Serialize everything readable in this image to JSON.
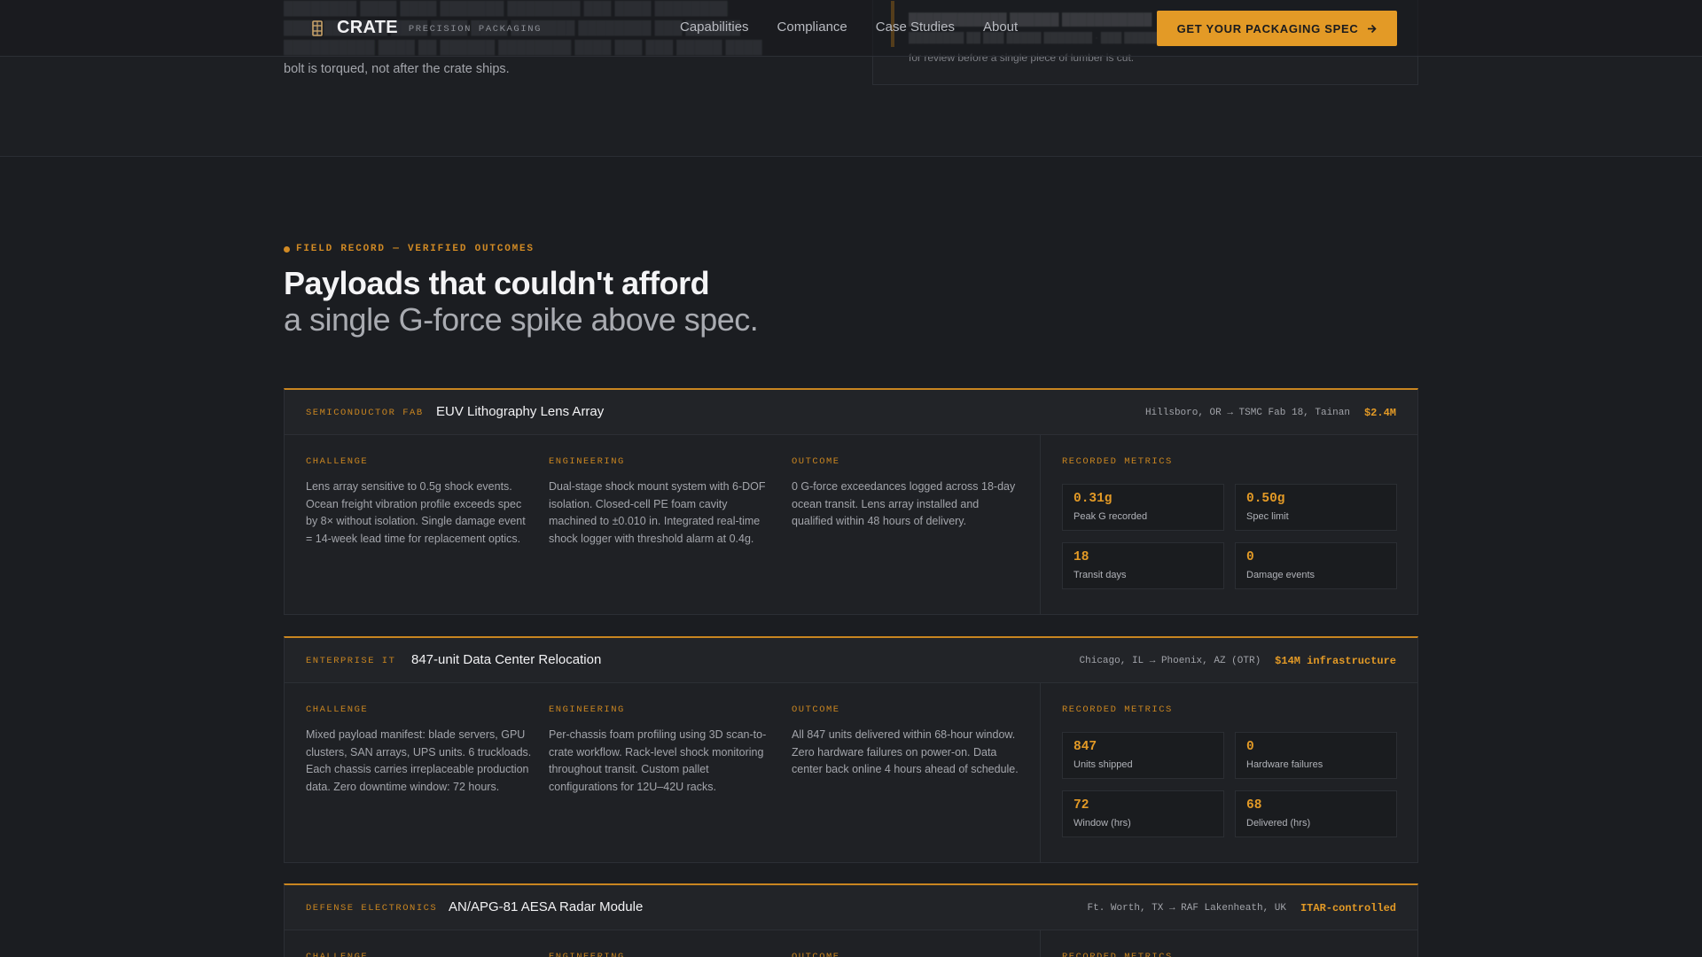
{
  "top": {
    "last_line": "bolt is torqued, not after the crate ships.",
    "card_sub": "for review before a single piece of lumber is cut."
  },
  "nav": {
    "brand": "CRATE",
    "tagline": "PRECISION PACKAGING",
    "links": [
      "Capabilities",
      "Compliance",
      "Case Studies",
      "About"
    ],
    "cta": "GET YOUR PACKAGING SPEC"
  },
  "section": {
    "eyebrow": "FIELD RECORD — VERIFIED OUTCOMES",
    "title": "Payloads that couldn't afford",
    "subtitle": "a single G-force spike above spec."
  },
  "labels": {
    "challenge": "CHALLENGE",
    "engineering": "ENGINEERING",
    "outcome": "OUTCOME",
    "metrics": "RECORDED METRICS"
  },
  "cases": [
    {
      "tag": "SEMICONDUCTOR FAB",
      "title": "EUV Lithography Lens Array",
      "route": "Hillsboro, OR → TSMC Fab 18, Tainan",
      "value": "$2.4M",
      "challenge": "Lens array sensitive to 0.5g shock events. Ocean freight vibration profile exceeds spec by 8× without isolation. Single damage event = 14-week lead time for replacement optics.",
      "engineering": "Dual-stage shock mount system with 6-DOF isolation. Closed-cell PE foam cavity machined to ±0.010 in. Integrated real-time shock logger with threshold alarm at 0.4g.",
      "outcome": "0 G-force exceedances logged across 18-day ocean transit. Lens array installed and qualified within 48 hours of delivery.",
      "metrics": [
        {
          "value": "0.31g",
          "label": "Peak G recorded"
        },
        {
          "value": "0.50g",
          "label": "Spec limit"
        },
        {
          "value": "18",
          "label": "Transit days"
        },
        {
          "value": "0",
          "label": "Damage events"
        }
      ]
    },
    {
      "tag": "ENTERPRISE IT",
      "title": "847-unit Data Center Relocation",
      "route": "Chicago, IL → Phoenix, AZ (OTR)",
      "value": "$14M infrastructure",
      "challenge": "Mixed payload manifest: blade servers, GPU clusters, SAN arrays, UPS units. 6 truckloads. Each chassis carries irreplaceable production data. Zero downtime window: 72 hours.",
      "engineering": "Per-chassis foam profiling using 3D scan-to-crate workflow. Rack-level shock monitoring throughout transit. Custom pallet configurations for 12U–42U racks.",
      "outcome": "All 847 units delivered within 68-hour window. Zero hardware failures on power-on. Data center back online 4 hours ahead of schedule.",
      "metrics": [
        {
          "value": "847",
          "label": "Units shipped"
        },
        {
          "value": "0",
          "label": "Hardware failures"
        },
        {
          "value": "72",
          "label": "Window (hrs)"
        },
        {
          "value": "68",
          "label": "Delivered (hrs)"
        }
      ]
    },
    {
      "tag": "DEFENSE ELECTRONICS",
      "title": "AN/APG-81 AESA Radar Module",
      "route": "Ft. Worth, TX → RAF Lakenheath, UK",
      "value": "ITAR-controlled"
    }
  ]
}
